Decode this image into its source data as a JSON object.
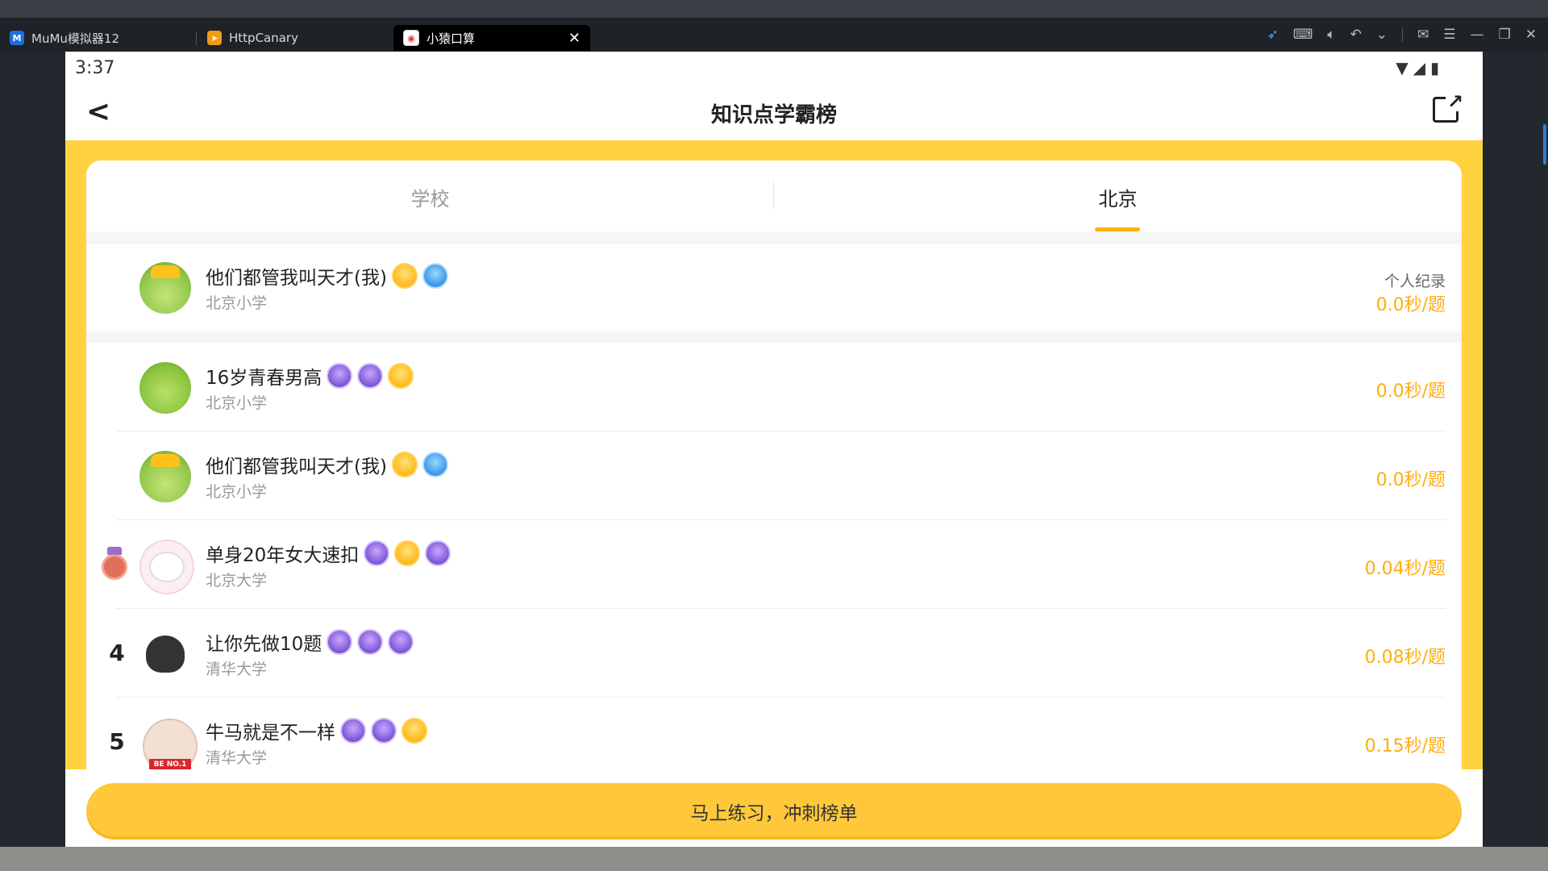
{
  "emulator": {
    "tabs": [
      {
        "label": "MuMu模拟器12",
        "icon": "mumu-logo-icon",
        "active": false
      },
      {
        "label": "HttpCanary",
        "icon": "httpcanary-logo-icon",
        "active": false
      },
      {
        "label": "小猿口算",
        "icon": "xiaoyuan-app-icon",
        "active": true
      }
    ],
    "close_glyph": "✕",
    "sys_icons": [
      "pointer-icon",
      "keyboard-icon",
      "volume-icon",
      "undo-icon",
      "chevron-down-icon",
      "mail-icon",
      "menu-icon",
      "minimize-icon",
      "restore-icon",
      "close-icon"
    ]
  },
  "status_bar": {
    "time": "3:37",
    "icons": [
      "wifi-icon",
      "signal-icon",
      "battery-icon"
    ]
  },
  "header": {
    "back_glyph": "<",
    "title": "知识点学霸榜",
    "share_icon": "share-icon"
  },
  "tabs": {
    "items": [
      "学校",
      "北京"
    ],
    "active_index": 1
  },
  "my_record": {
    "name": "他们都管我叫天才(我)",
    "school": "北京小学",
    "label": "个人纪录",
    "score": "0.0秒/题",
    "avatar": "green-crown-avatar",
    "badges": [
      "gold",
      "blue"
    ]
  },
  "ranking": [
    {
      "rank": "",
      "name": "16岁青春男高",
      "school": "北京小学",
      "score": "0.0秒/题",
      "avatar": "green-avatar",
      "badges": [
        "purple",
        "purple",
        "gold"
      ]
    },
    {
      "rank": "",
      "name": "他们都管我叫天才(我)",
      "school": "北京小学",
      "score": "0.0秒/题",
      "avatar": "green-crown-avatar",
      "badges": [
        "gold",
        "blue"
      ]
    },
    {
      "rank": "medal",
      "name": "单身20年女大速扣",
      "school": "北京大学",
      "score": "0.04秒/题",
      "avatar": "white-cat-avatar",
      "badges": [
        "purple",
        "gold",
        "purple"
      ]
    },
    {
      "rank": "4",
      "name": "让你先做10题",
      "school": "清华大学",
      "score": "0.08秒/题",
      "avatar": "dark-avatar",
      "badges": [
        "purple",
        "purple",
        "purple"
      ]
    },
    {
      "rank": "5",
      "name": "牛马就是不一样",
      "school": "清华大学",
      "score": "0.15秒/题",
      "avatar": "pig-avatar",
      "badges": [
        "purple",
        "purple",
        "gold"
      ]
    }
  ],
  "cta": {
    "label": "马上练习，冲刺榜单"
  },
  "colors": {
    "accent_yellow": "#ffd23f",
    "score_orange": "#ffad0d",
    "tab_underline": "#ffb300"
  }
}
